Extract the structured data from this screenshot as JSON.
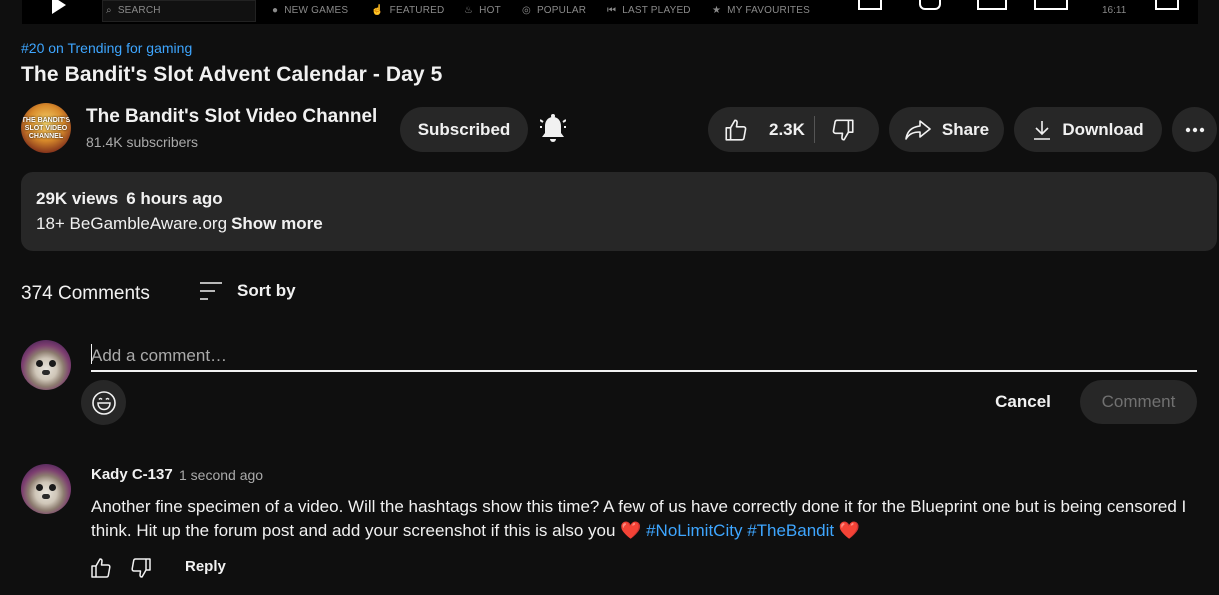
{
  "player_bar": {
    "search_label": "SEARCH",
    "nav": [
      "NEW GAMES",
      "FEATURED",
      "HOT",
      "POPULAR",
      "LAST PLAYED",
      "MY FAVOURITES"
    ],
    "clock": "16:11"
  },
  "video": {
    "trending": "#20 on Trending for gaming",
    "title": "The Bandit's Slot Advent Calendar - Day 5"
  },
  "channel": {
    "avatar_text": [
      "THE BANDIT'S",
      "SLOT VIDEO",
      "CHANNEL"
    ],
    "name": "The Bandit's Slot Video Channel",
    "subscribers": "81.4K subscribers",
    "subscribe_label": "Subscribed"
  },
  "actions": {
    "like_count": "2.3K",
    "share_label": "Share",
    "download_label": "Download"
  },
  "description": {
    "views": "29K views",
    "age": "6 hours ago",
    "text": "18+ BeGambleAware.org",
    "show_more": "Show more"
  },
  "comments": {
    "count_label": "374 Comments",
    "sort_label": "Sort by",
    "input_placeholder": "Add a comment…",
    "cancel_label": "Cancel",
    "submit_label": "Comment",
    "items": [
      {
        "author": "Kady C-137",
        "time": "1 second ago",
        "text": "Another fine specimen of a video. Will the hashtags show this time? A few of us have correctly done it for the Blueprint one but is being censored I think. Hit up the forum post and add your screenshot if this is also you",
        "heart": "❤️",
        "hashtags": [
          "#NoLimitCity",
          "#TheBandit"
        ],
        "reply_label": "Reply"
      }
    ]
  },
  "colors": {
    "background": "#0f0f0f",
    "surface": "#272727",
    "link": "#3ea6ff",
    "text": "#f1f1f1",
    "muted": "#aaaaaa"
  }
}
